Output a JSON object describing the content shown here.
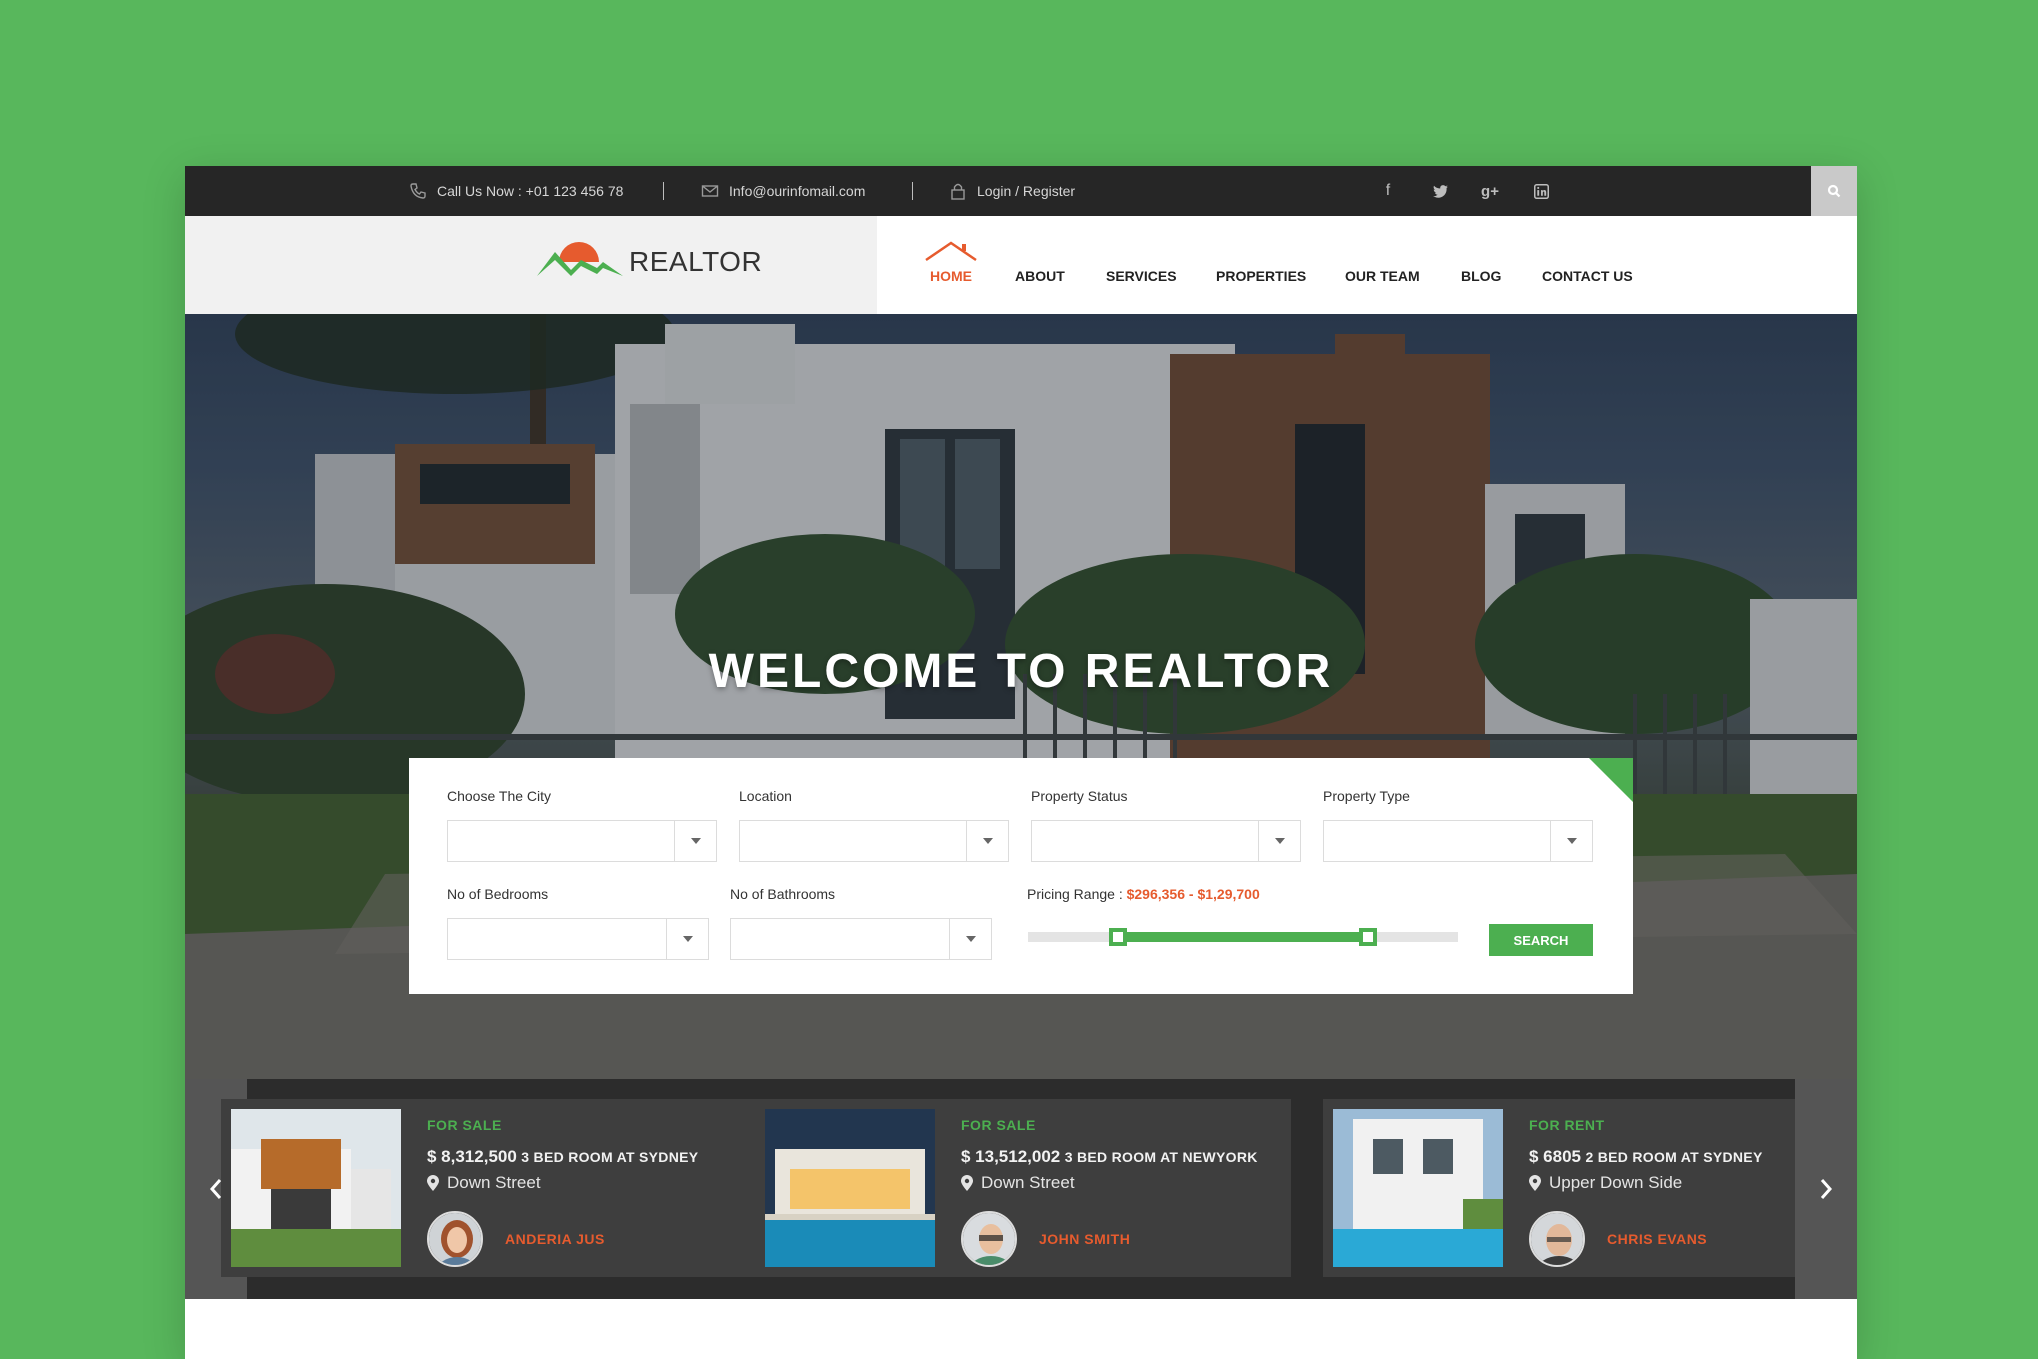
{
  "topbar": {
    "phone": "Call Us Now : +01 123 456 78",
    "email": "Info@ourinfomail.com",
    "login": "Login / Register",
    "social": [
      {
        "icon": "facebook-icon",
        "glyph": "f"
      },
      {
        "icon": "twitter-icon",
        "glyph": "t"
      },
      {
        "icon": "google-plus-icon",
        "glyph": "g+"
      },
      {
        "icon": "linkedin-icon",
        "glyph": "in"
      }
    ]
  },
  "brand": {
    "name": "REALTOR",
    "accent": "#e65b2e",
    "green": "#4caf50"
  },
  "nav": [
    "HOME",
    "ABOUT",
    "SERVICES",
    "PROPERTIES",
    "OUR TEAM",
    "BLOG",
    "CONTACT US"
  ],
  "hero": {
    "title": "WELCOME TO REALTOR"
  },
  "search": {
    "city_label": "Choose The City",
    "location_label": "Location",
    "status_label": "Property Status",
    "type_label": "Property Type",
    "bedrooms_label": "No of Bedrooms",
    "bathrooms_label": "No of Bathrooms",
    "price_label": "Pricing Range :",
    "price_value": "$296,356 - $1,29,700",
    "price_slider_min": 0.21,
    "price_slider_max": 0.79,
    "button": "SEARCH"
  },
  "listings": [
    {
      "status": "FOR SALE",
      "price": "$ 8,312,500",
      "title": "3 BED ROOM AT SYDNEY",
      "address": "Down Street",
      "agent": "ANDERIA JUS"
    },
    {
      "status": "FOR SALE",
      "price": "$ 13,512,002",
      "title": "3 BED ROOM AT NEWYORK",
      "address": "Down Street",
      "agent": "JOHN SMITH"
    },
    {
      "status": "FOR RENT",
      "price": "$ 6805",
      "title": "2 BED ROOM AT SYDNEY",
      "address": "Upper Down Side",
      "agent": "CHRIS EVANS"
    }
  ]
}
